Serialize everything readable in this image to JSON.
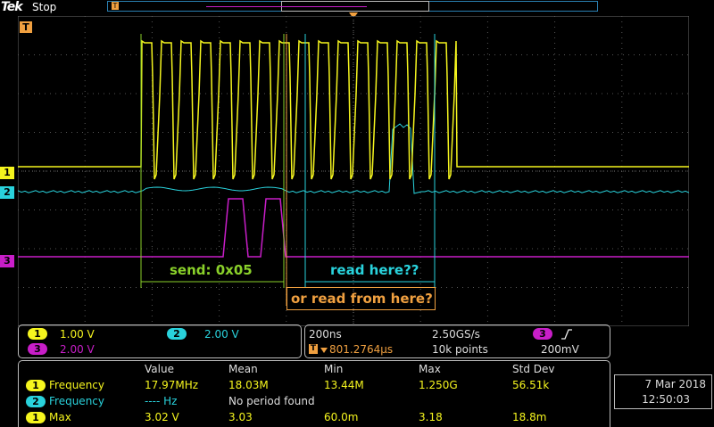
{
  "header": {
    "brand": "Tek",
    "status": "Stop"
  },
  "channels": [
    {
      "id": "1",
      "color": "#f5f51e"
    },
    {
      "id": "2",
      "color": "#29d2dc"
    },
    {
      "id": "3",
      "color": "#c81ec8"
    }
  ],
  "markers": {
    "trigger_level": "T",
    "ch1": "1",
    "ch2": "2",
    "ch3": "3"
  },
  "annotations": {
    "send": "send: 0x05",
    "read_here": "read here??",
    "read_from_here": "or read from here?"
  },
  "colors": {
    "ch1": "#f5f51e",
    "ch2": "#29d2dc",
    "ch3": "#c81ec8",
    "send_annotation": "#8ad12a",
    "read_annotation": "#29d2dc",
    "alt_annotation": "#f0a040",
    "grid": "#555555"
  },
  "scale_panel": {
    "ch1_scale": "1.00 V",
    "ch2_scale": "2.00 V",
    "ch3_scale": "2.00 V"
  },
  "timebase_panel": {
    "time_div": "200ns",
    "sample_rate": "2.50GS/s",
    "trigger_position": "801.2764µs",
    "record_length": "10k points",
    "trigger_source": "3",
    "trigger_slope_icon": "rising-edge-icon",
    "trigger_level_value": "200mV"
  },
  "measurements": {
    "headers": [
      "Value",
      "Mean",
      "Min",
      "Max",
      "Std Dev"
    ],
    "rows": [
      {
        "ch": "1",
        "name": "Frequency",
        "value": "17.97MHz",
        "mean": "18.03M",
        "min": "13.44M",
        "max": "1.250G",
        "std": "56.51k"
      },
      {
        "ch": "2",
        "name": "Frequency",
        "value": "---- Hz",
        "mean": "No period found",
        "min": "",
        "max": "",
        "std": ""
      },
      {
        "ch": "1",
        "name": "Max",
        "value": "3.02 V",
        "mean": "3.03",
        "min": "60.0m",
        "max": "3.18",
        "std": "18.8m"
      }
    ]
  },
  "datetime": {
    "date": "7 Mar  2018",
    "time": "12:50:03"
  }
}
